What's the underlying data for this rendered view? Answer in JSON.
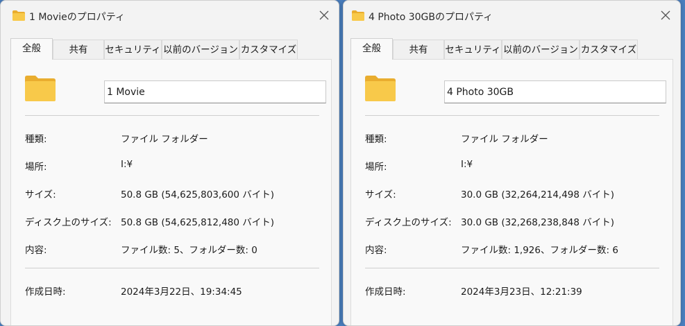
{
  "colors": {
    "folder_yellow": "#f8c94a",
    "folder_back": "#e9ad2f",
    "window_bg": "#f3f3f3",
    "desktop_bg": "#4a7fbf"
  },
  "windows": [
    {
      "title": "1 Movieのプロパティ",
      "tabs": [
        "全般",
        "共有",
        "セキュリティ",
        "以前のバージョン",
        "カスタマイズ"
      ],
      "active_tab": "全般",
      "name_value": "1 Movie",
      "rows": [
        {
          "label": "種類:",
          "value": "ファイル フォルダー"
        },
        {
          "label": "場所:",
          "value": "I:¥"
        },
        {
          "label": "サイズ:",
          "value": "50.8 GB (54,625,803,600 バイト)"
        },
        {
          "label": "ディスク上のサイズ:",
          "value": "50.8 GB (54,625,812,480 バイト)"
        },
        {
          "label": "内容:",
          "value": "ファイル数: 5、フォルダー数: 0"
        },
        {
          "label": "作成日時:",
          "value": "2024年3月22日、19:34:45"
        }
      ]
    },
    {
      "title": "4 Photo 30GBのプロパティ",
      "tabs": [
        "全般",
        "共有",
        "セキュリティ",
        "以前のバージョン",
        "カスタマイズ"
      ],
      "active_tab": "全般",
      "name_value": "4 Photo 30GB",
      "rows": [
        {
          "label": "種類:",
          "value": "ファイル フォルダー"
        },
        {
          "label": "場所:",
          "value": "I:¥"
        },
        {
          "label": "サイズ:",
          "value": "30.0 GB (32,264,214,498 バイト)"
        },
        {
          "label": "ディスク上のサイズ:",
          "value": "30.0 GB (32,268,238,848 バイト)"
        },
        {
          "label": "内容:",
          "value": "ファイル数: 1,926、フォルダー数: 6"
        },
        {
          "label": "作成日時:",
          "value": "2024年3月23日、12:21:39"
        }
      ]
    }
  ]
}
